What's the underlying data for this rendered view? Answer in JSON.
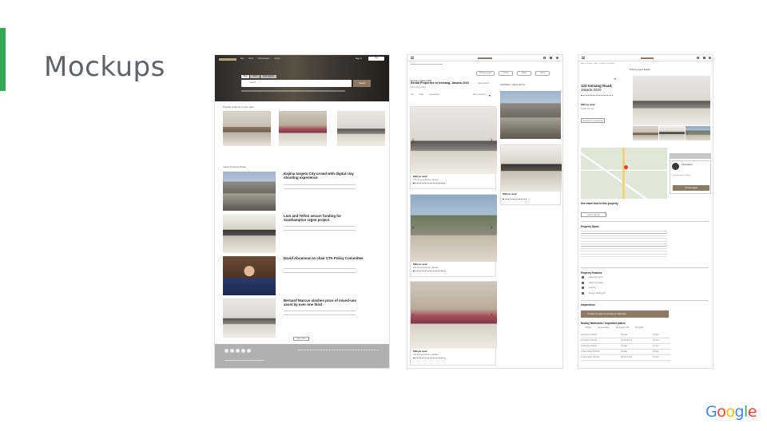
{
  "slide": {
    "title": "Mockups"
  },
  "logo": {
    "letters": [
      "G",
      "o",
      "o",
      "g",
      "l",
      "e"
    ],
    "colors": [
      "#4285f4",
      "#ea4335",
      "#fbbc05",
      "#4285f4",
      "#34a853",
      "#ea4335"
    ]
  },
  "colors": {
    "accent_green": "#34a853",
    "brand_brown": "#8c7a64"
  },
  "mockup1": {
    "nav_items": [
      "Buy",
      "Rent",
      "Sell property",
      "About"
    ],
    "sign_in": "Sign in",
    "join": "Join",
    "search_tabs": [
      "Buy",
      "Rent",
      "Sold agents"
    ],
    "search_placeholder": "Search",
    "search_button": "Search",
    "popular_heading": "Popular property in your area",
    "news_heading": "Latest Property News",
    "news": [
      {
        "title": "Kajima targets City crowd with digital clay shooting experience"
      },
      {
        "title": "L&G and Telfon secure funding for Southampton regen project"
      },
      {
        "title": "David Abramson to chair CTA Policy Committee"
      },
      {
        "title": "Bernard Marcus slashes price of mixed-use asset by over one third"
      }
    ],
    "see_more": "See more"
  },
  "mockup2": {
    "search_value": "Kemang, Jakarta 2020",
    "filters": [
      "Property type",
      "Price",
      "Beds",
      "More"
    ],
    "heading": "Rental Properties in Kemang, Jakarta 2020",
    "results": "12 of 231 results",
    "save_search": "Save search",
    "view_tabs": [
      "List",
      "Map",
      "Inspections"
    ],
    "sort": "Most relevant",
    "side_heading": "PROPERTY HIGHLIGHTS",
    "listings": [
      {
        "price": "$300 per week",
        "address": "123 Kemang Road, Jakarta"
      },
      {
        "price": "$300 per week",
        "address": "123 Kemang Road, Jakarta"
      },
      {
        "price": "$300 per week",
        "address": "123 Kemang Road, Jakarta"
      }
    ],
    "side_listing": {
      "price": "$300 per week"
    }
  },
  "mockup3": {
    "breadcrumb": "Back to results  >  Rent  >  Jakarta  >  Kemang",
    "banner": "Property Agent header",
    "address_line1": "123 Kemang Road,",
    "address_line2": "Jakarta 2020",
    "price": "$300 per week",
    "type": "House for rent",
    "request_button": "Request an inspection",
    "agent_name": "Annie Ernst",
    "agent_sub": "Property agent - Jakarta",
    "agent_button": "Contact agent",
    "travel_heading": "See travel time to this property",
    "add_location": "Add locations",
    "name_heading": "Property Name",
    "features_heading": "Property features",
    "features": [
      "Rental property",
      "Rooms & tables",
      "Laundry",
      "Energy Rating 4/5"
    ],
    "inspections_heading": "Inspections",
    "inspection_bar": "Contact the agent to arrange an inspection",
    "schools_heading": "Nearby landmarks / important places",
    "school_cols": [
      "School",
      "Supermarket",
      "Shopping mall",
      "Hospital"
    ],
    "schools": [
      [
        "A Primary School",
        "Private",
        "0.3 km"
      ],
      [
        "A Primary School",
        "Government",
        "0.6 km"
      ],
      [
        "A Primary School",
        "Private",
        "1.2 km"
      ],
      [
        "A Secondary School",
        "Private",
        "1.8 km"
      ],
      [
        "A Secondary School",
        "Government",
        "2.3 km"
      ]
    ]
  }
}
